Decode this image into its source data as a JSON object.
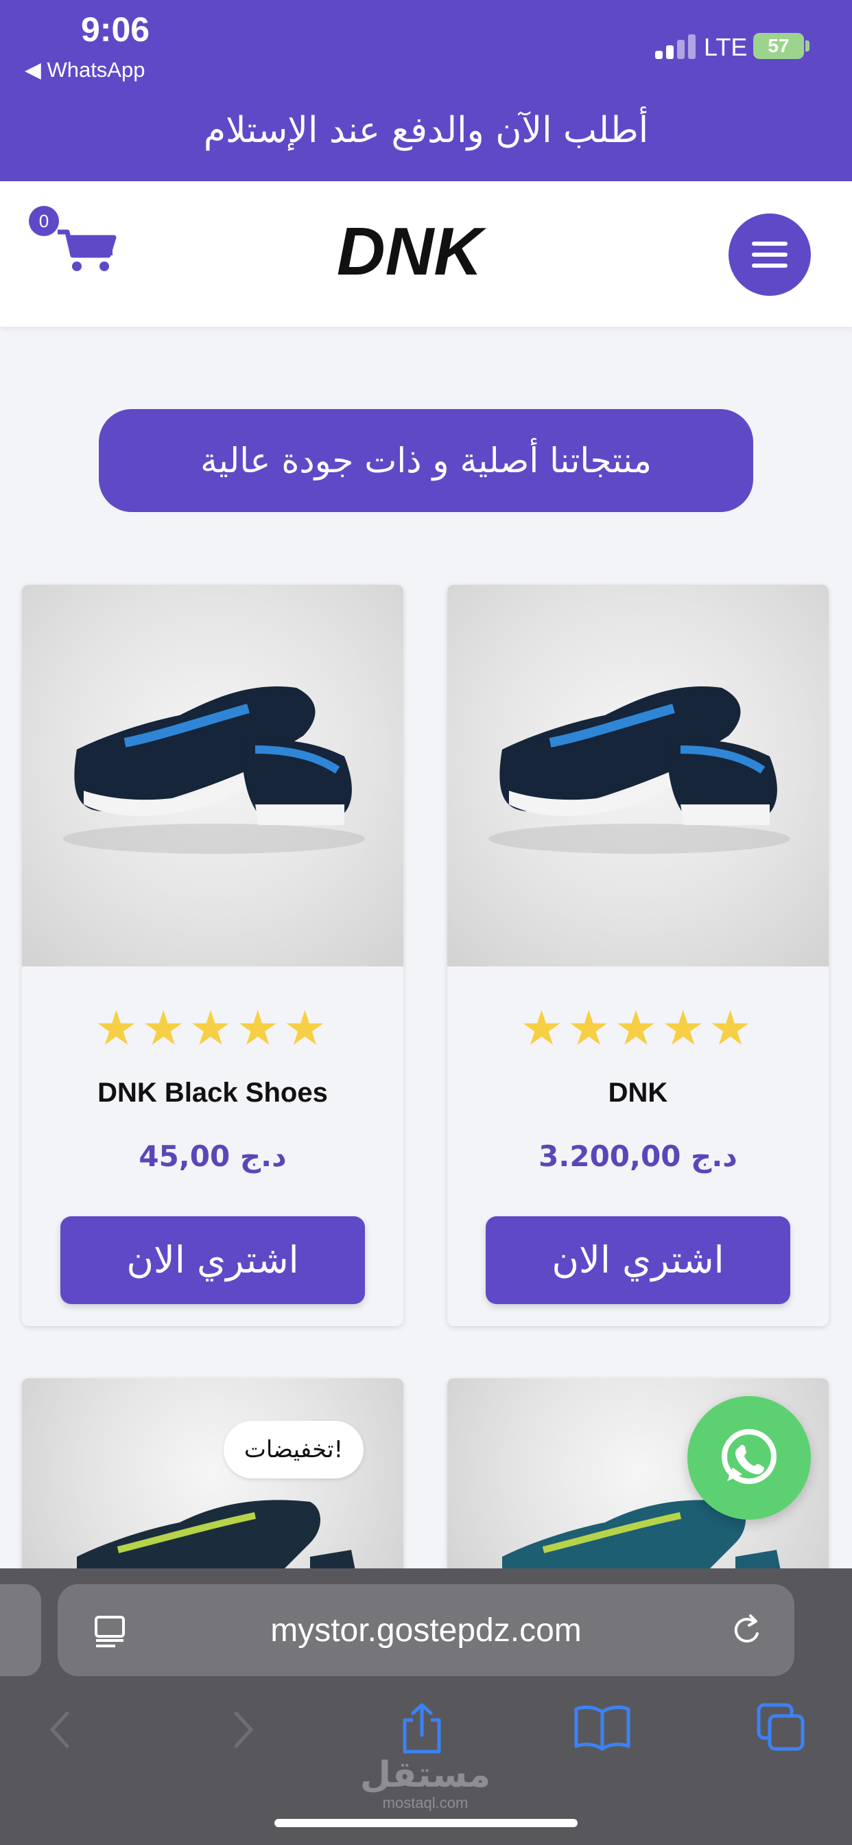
{
  "status_bar": {
    "time": "9:06",
    "back_app": "◀ WhatsApp",
    "network": "LTE",
    "battery": "57"
  },
  "promo_banner": "أطلب الآن والدفع  عند الإستلام",
  "header": {
    "cart_count": "0",
    "logo_text": "DNK"
  },
  "section_heading": "منتجاتنا أصلية و ذات جودة عالية",
  "products": [
    {
      "name": "DNK",
      "price": "3.200,00 د.ج",
      "rating": "★★★★★",
      "buy_label": "اشتري الان"
    },
    {
      "name": "DNK Black Shoes",
      "price": "45,00 د.ج",
      "rating": "★★★★★",
      "buy_label": "اشتري الان"
    }
  ],
  "sale_badge": "تخفيضات!",
  "browser": {
    "url": "mystor.gostepdz.com"
  },
  "watermark": {
    "arabic": "مستقل",
    "latin": "mostaql.com"
  },
  "colors": {
    "brand": "#6049c7",
    "star": "#f7cf44",
    "whatsapp": "#5dd171"
  }
}
